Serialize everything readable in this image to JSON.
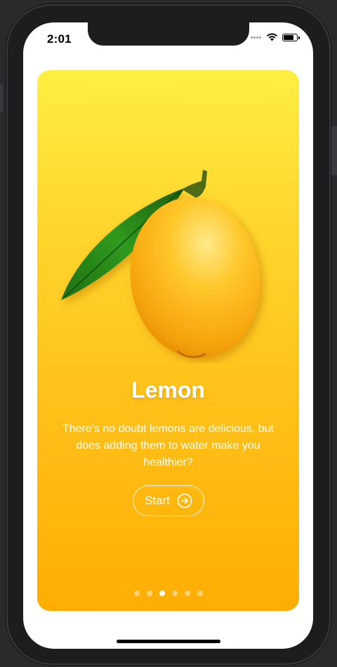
{
  "status_bar": {
    "time": "2:01"
  },
  "card": {
    "title": "Lemon",
    "description": "There's no doubt lemons are delicious, but does adding them to water make you healthier?",
    "start_label": "Start",
    "pagination": {
      "count": 6,
      "active_index": 2
    }
  },
  "icons": {
    "fruit": "lemon-image",
    "start": "arrow-right-circle-icon",
    "wifi": "wifi-icon",
    "battery": "battery-icon"
  },
  "colors": {
    "card_top": "#ffee42",
    "card_bottom": "#ffad04",
    "text": "#ffffff"
  }
}
